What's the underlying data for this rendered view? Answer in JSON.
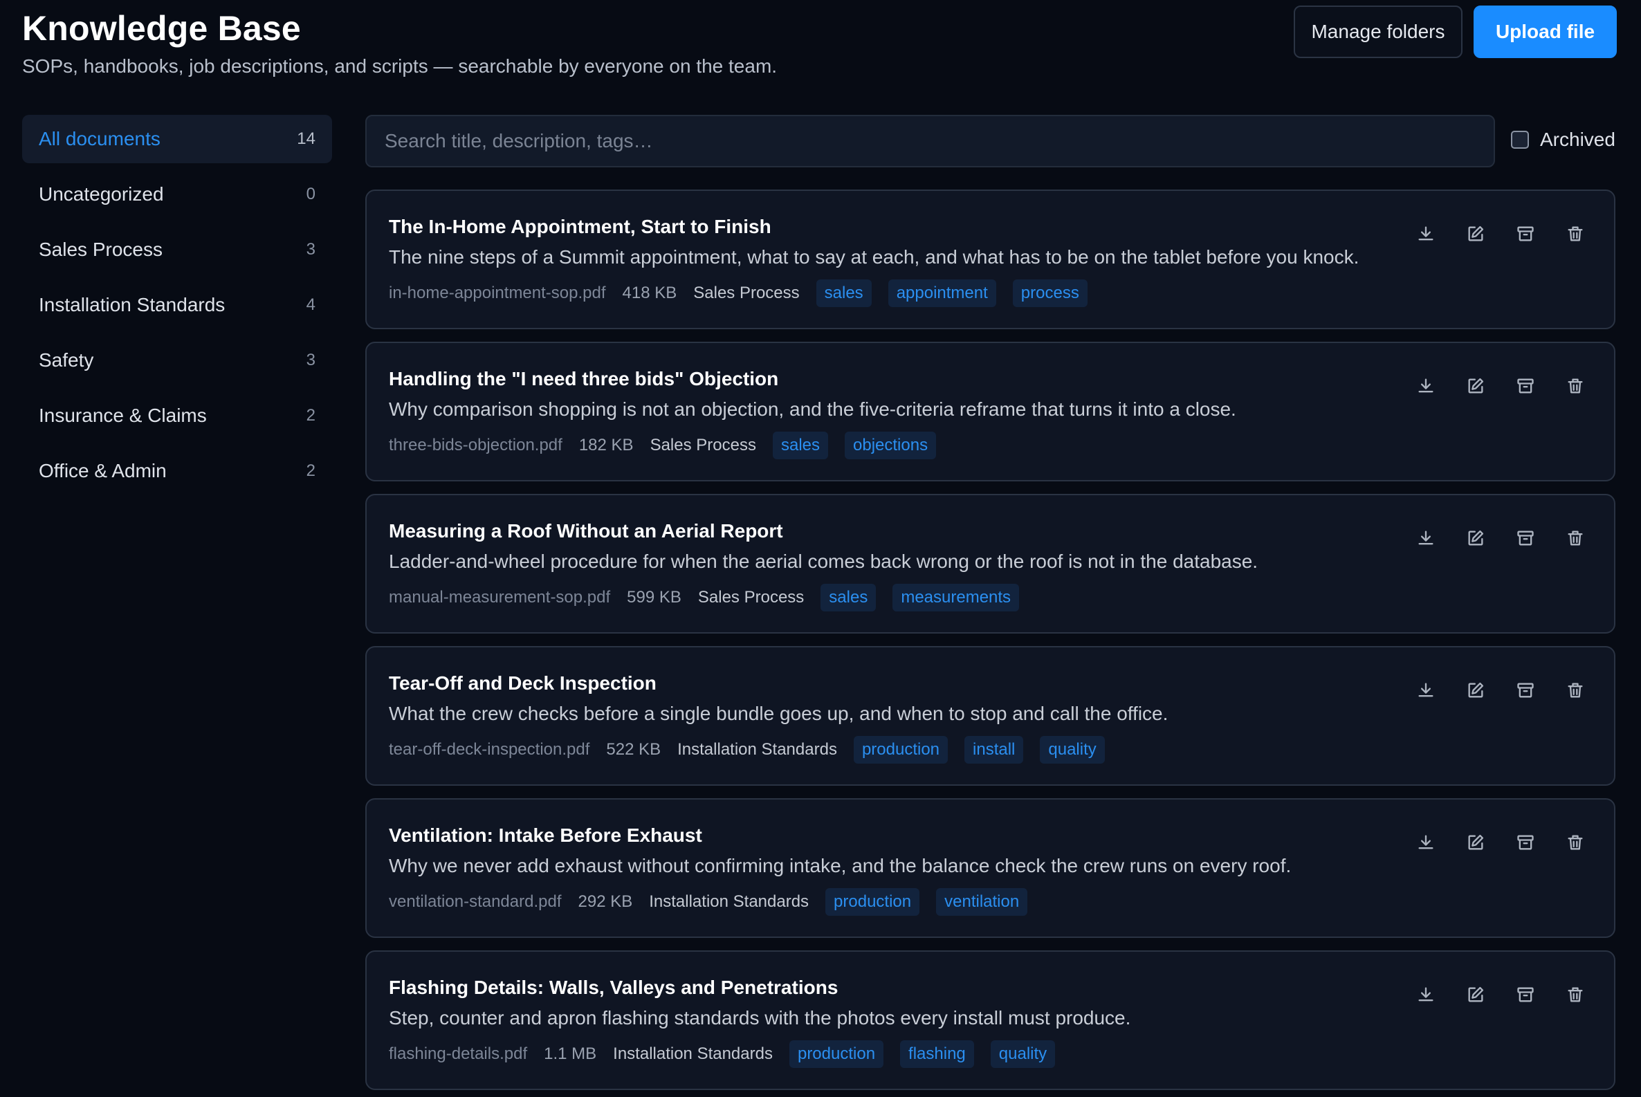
{
  "header": {
    "title": "Knowledge Base",
    "subtitle": "SOPs, handbooks, job descriptions, and scripts — searchable by everyone on the team.",
    "manage_folders_label": "Manage folders",
    "upload_label": "Upload file"
  },
  "sidebar": {
    "folders": [
      {
        "label": "All documents",
        "count": "14",
        "active": true
      },
      {
        "label": "Uncategorized",
        "count": "0"
      },
      {
        "label": "Sales Process",
        "count": "3"
      },
      {
        "label": "Installation Standards",
        "count": "4"
      },
      {
        "label": "Safety",
        "count": "3"
      },
      {
        "label": "Insurance & Claims",
        "count": "2"
      },
      {
        "label": "Office & Admin",
        "count": "2"
      }
    ]
  },
  "search": {
    "placeholder": "Search title, description, tags…",
    "value": ""
  },
  "archived_filter": {
    "label": "Archived",
    "checked": false
  },
  "documents": [
    {
      "title": "The In-Home Appointment, Start to Finish",
      "description": "The nine steps of a Summit appointment, what to say at each, and what has to be on the tablet before you knock.",
      "file": "in-home-appointment-sop.pdf",
      "size": "418 KB",
      "folder": "Sales Process",
      "tags": [
        "sales",
        "appointment",
        "process"
      ]
    },
    {
      "title": "Handling the \"I need three bids\" Objection",
      "description": "Why comparison shopping is not an objection, and the five-criteria reframe that turns it into a close.",
      "file": "three-bids-objection.pdf",
      "size": "182 KB",
      "folder": "Sales Process",
      "tags": [
        "sales",
        "objections"
      ]
    },
    {
      "title": "Measuring a Roof Without an Aerial Report",
      "description": "Ladder-and-wheel procedure for when the aerial comes back wrong or the roof is not in the database.",
      "file": "manual-measurement-sop.pdf",
      "size": "599 KB",
      "folder": "Sales Process",
      "tags": [
        "sales",
        "measurements"
      ]
    },
    {
      "title": "Tear-Off and Deck Inspection",
      "description": "What the crew checks before a single bundle goes up, and when to stop and call the office.",
      "file": "tear-off-deck-inspection.pdf",
      "size": "522 KB",
      "folder": "Installation Standards",
      "tags": [
        "production",
        "install",
        "quality"
      ]
    },
    {
      "title": "Ventilation: Intake Before Exhaust",
      "description": "Why we never add exhaust without confirming intake, and the balance check the crew runs on every roof.",
      "file": "ventilation-standard.pdf",
      "size": "292 KB",
      "folder": "Installation Standards",
      "tags": [
        "production",
        "ventilation"
      ]
    },
    {
      "title": "Flashing Details: Walls, Valleys and Penetrations",
      "description": "Step, counter and apron flashing standards with the photos every install must produce.",
      "file": "flashing-details.pdf",
      "size": "1.1 MB",
      "folder": "Installation Standards",
      "tags": [
        "production",
        "flashing",
        "quality"
      ]
    }
  ],
  "icons": {
    "download": "download-icon",
    "edit": "edit-icon",
    "archive": "archive-icon",
    "delete": "trash-icon"
  },
  "colors": {
    "background": "#070b14",
    "card": "#0f1523",
    "accent": "#1a8cff",
    "tag_bg": "#12233d",
    "tag_text": "#2b8ff0"
  }
}
